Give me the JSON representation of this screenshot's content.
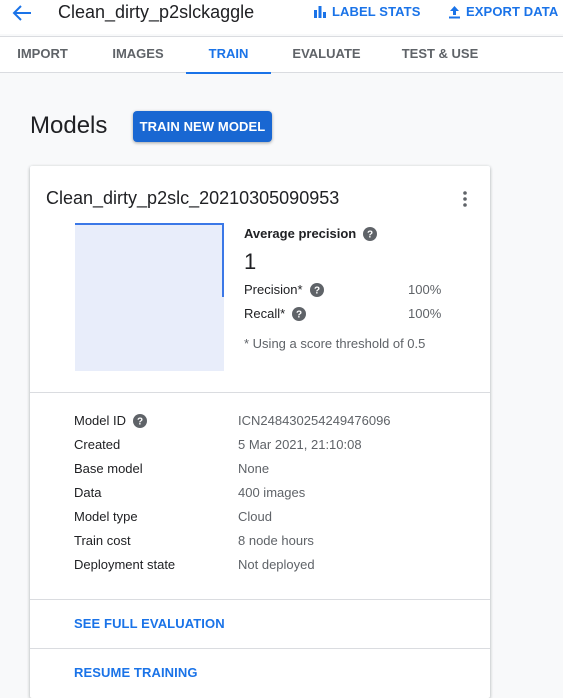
{
  "header": {
    "dataset_title": "Clean_dirty_p2slckaggle",
    "label_stats": "LABEL STATS",
    "export_data": "EXPORT DATA"
  },
  "tabs": [
    {
      "label": "IMPORT",
      "active": false
    },
    {
      "label": "IMAGES",
      "active": false
    },
    {
      "label": "TRAIN",
      "active": true
    },
    {
      "label": "EVALUATE",
      "active": false
    },
    {
      "label": "TEST & USE",
      "active": false
    }
  ],
  "page": {
    "title": "Models",
    "train_button": "TRAIN NEW MODEL"
  },
  "model_card": {
    "name": "Clean_dirty_p2slc_20210305090953",
    "average_precision_label": "Average precision",
    "average_precision_value": "1",
    "precision_label": "Precision*",
    "precision_value": "100%",
    "recall_label": "Recall*",
    "recall_value": "100%",
    "threshold_note": "* Using a score threshold of 0.5",
    "details": [
      {
        "label": "Model ID",
        "value": "ICN248430254249476096"
      },
      {
        "label": "Created",
        "value": "5 Mar 2021, 21:10:08"
      },
      {
        "label": "Base model",
        "value": "None"
      },
      {
        "label": "Data",
        "value": "400 images"
      },
      {
        "label": "Model type",
        "value": "Cloud"
      },
      {
        "label": "Train cost",
        "value": "8 node hours"
      },
      {
        "label": "Deployment state",
        "value": "Not deployed"
      }
    ],
    "see_full_evaluation": "SEE FULL EVALUATION",
    "resume_training": "RESUME TRAINING"
  },
  "colors": {
    "accent": "#1a73e8",
    "button": "#1967d2",
    "plot_fill": "#e8edfa"
  }
}
